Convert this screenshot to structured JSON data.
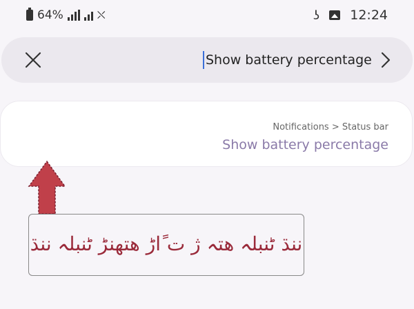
{
  "status_bar": {
    "battery_percent": "64%",
    "time": "12:24",
    "icons": [
      "battery-icon",
      "signal-icon",
      "wifi-off-icon",
      "gallery-icon",
      "notification-icon"
    ]
  },
  "search": {
    "query": "Show battery percentage",
    "close_icon": "close-icon",
    "back_icon": "back-arrow-icon"
  },
  "result": {
    "breadcrumb": "Notifications > Status bar",
    "title": "Show battery percentage"
  },
  "annotation": {
    "text": "ننڌ ٹنبلہ ھتہ ژ ت ًاڑ ھتهنڑ ٹنبلہ ننڌ",
    "arrow_color": "#c0404a",
    "text_color": "#9a2a3a"
  },
  "colors": {
    "background": "#f7f5f9",
    "search_bg": "#ebe8ee",
    "card_bg": "#ffffff",
    "highlight": "#8a7aa8",
    "cursor": "#3a6fd8"
  }
}
